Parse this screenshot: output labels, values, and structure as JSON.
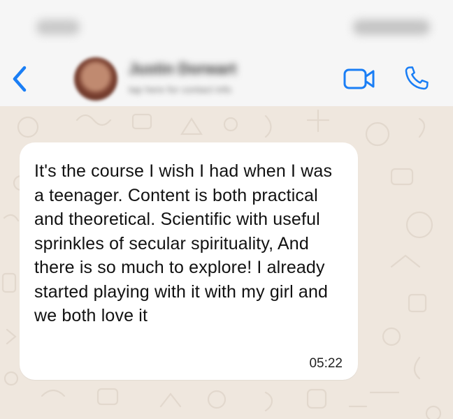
{
  "status_bar": {
    "time": "9:41",
    "icons": "signal-wifi-battery"
  },
  "header": {
    "back_icon": "chevron-left-icon",
    "contact_name": "Justin Dorwart",
    "contact_status": "tap here for contact info",
    "video_icon": "video-camera-icon",
    "call_icon": "phone-icon",
    "accent_color": "#1a7ef5"
  },
  "chat": {
    "wallpaper_color": "#efe7de",
    "messages": [
      {
        "text": "It's the course I wish I had when I was a teenager. Content is both practical and theoretical. Scientific with useful sprinkles of secular spirituality, And there is so much to explore! I already started playing with it with my girl and we both love it",
        "time": "05:22",
        "direction": "incoming",
        "bubble_color": "#ffffff"
      }
    ]
  }
}
